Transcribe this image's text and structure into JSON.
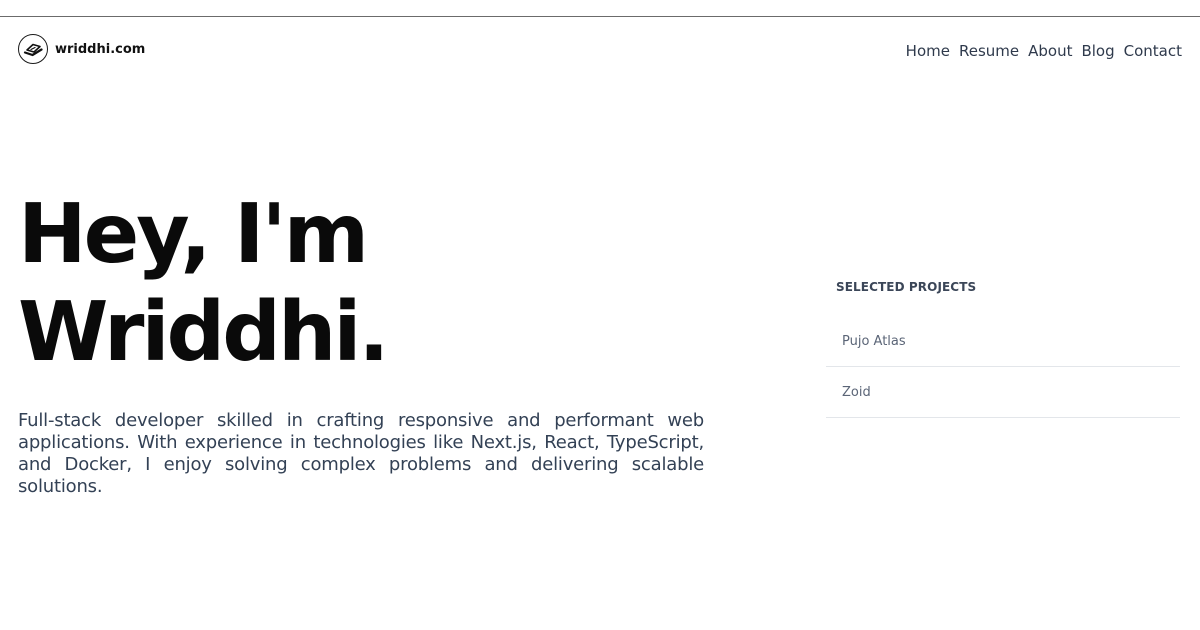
{
  "header": {
    "brand_name": "wriddhi.com",
    "logo_icon": "laptop-logo-icon",
    "nav": [
      {
        "label": "Home"
      },
      {
        "label": "Resume"
      },
      {
        "label": "About"
      },
      {
        "label": "Blog"
      },
      {
        "label": "Contact"
      }
    ]
  },
  "hero": {
    "title_line1": "Hey, I'm",
    "title_line2": "Wriddhi.",
    "bio": "Full-stack developer skilled in crafting responsive and performant web applications. With experience in technologies like Next.js, React, TypeScript, and Docker, I enjoy solving complex problems and delivering scalable solutions."
  },
  "projects": {
    "heading": "SELECTED PROJECTS",
    "items": [
      {
        "label": "Pujo Atlas"
      },
      {
        "label": "Zoid"
      }
    ]
  }
}
